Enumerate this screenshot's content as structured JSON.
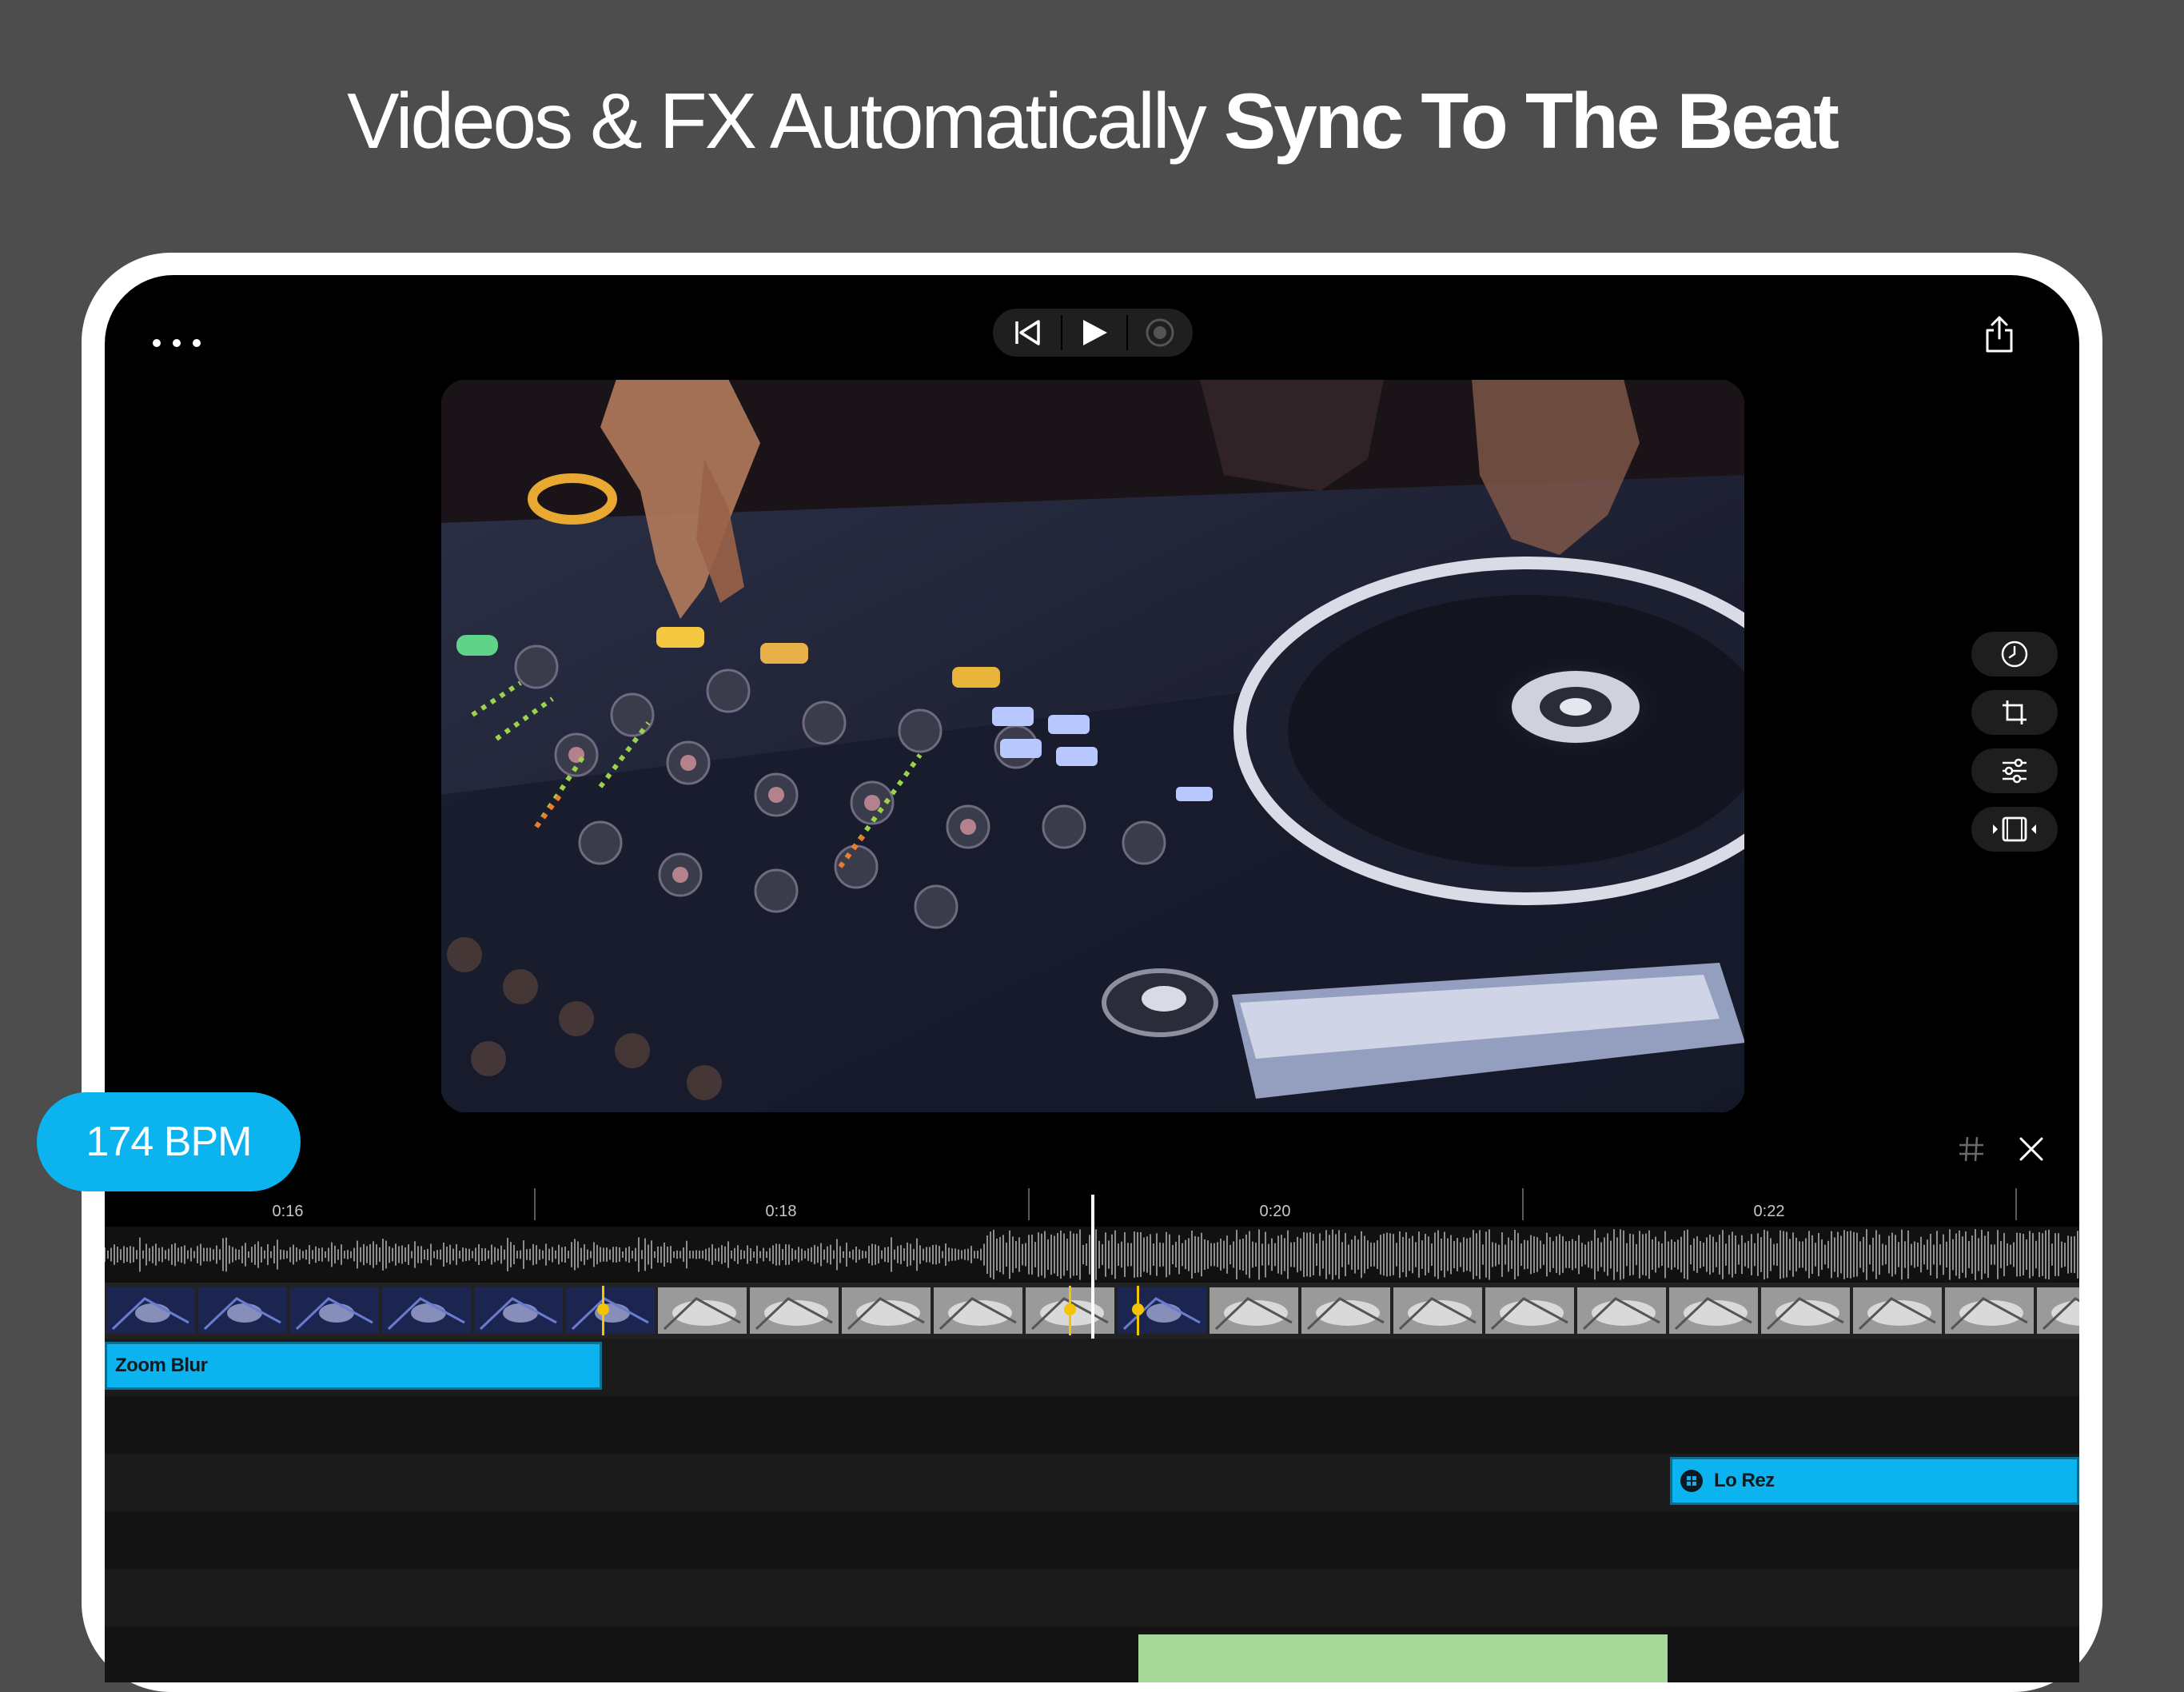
{
  "headline": {
    "light": "Videos & FX Automatically ",
    "bold": "Sync To The Beat"
  },
  "toolbar": {
    "menu_icon": "more-dots-icon",
    "transport_icons": [
      "skip-to-start-icon",
      "play-icon",
      "record-icon"
    ],
    "share_icon": "share-icon"
  },
  "side_tools": [
    "clock-icon",
    "crop-icon",
    "sliders-icon",
    "clip-trim-icon"
  ],
  "timeline": {
    "time_labels": [
      "0:16",
      "0:18",
      "0:20",
      "0:22"
    ],
    "grid_icon": "grid-icon",
    "close_icon": "close-icon"
  },
  "effects": {
    "zoom_blur": "Zoom Blur",
    "lo_rez": "Lo Rez"
  },
  "bpm": "174 BPM",
  "colors": {
    "accent": "#0bb4ee",
    "beat_marker": "#f5c400",
    "background": "#4d4d4d"
  }
}
